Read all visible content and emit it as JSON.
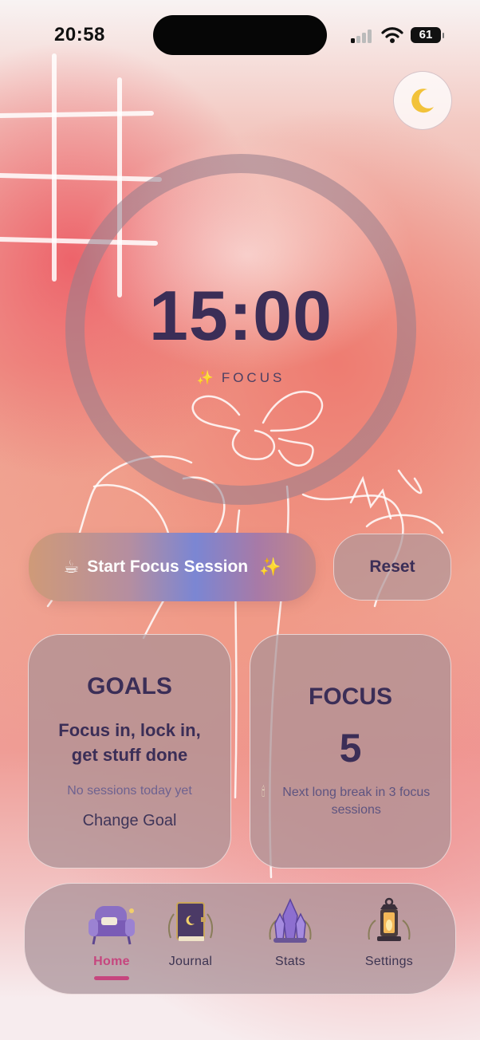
{
  "status_bar": {
    "time": "20:58",
    "battery": "61"
  },
  "theme_toggle": {
    "icon": "moon-icon",
    "emoji": "🌙"
  },
  "timer": {
    "time": "15:00",
    "mode_icon": "✨",
    "mode": "FOCUS"
  },
  "controls": {
    "start_icon": "☕",
    "start_label": "Start Focus Session",
    "start_spark": "✨",
    "reset_label": "Reset"
  },
  "goals_card": {
    "title": "GOALS",
    "goal": "Focus in, lock in, get stuff done",
    "status": "No sessions today yet",
    "change_label": "Change Goal"
  },
  "focus_card": {
    "title": "FOCUS",
    "count": "5",
    "note_icon": "🕯",
    "note": "Next long break in 3 focus sessions"
  },
  "tabs": [
    {
      "label": "Home",
      "icon": "armchair-icon",
      "active": true
    },
    {
      "label": "Journal",
      "icon": "book-icon",
      "active": false
    },
    {
      "label": "Stats",
      "icon": "crystal-icon",
      "active": false
    },
    {
      "label": "Settings",
      "icon": "lantern-icon",
      "active": false
    }
  ],
  "colors": {
    "text_primary": "#3b2e57",
    "active_tab": "#c6457e",
    "spark": "#e9b73d"
  }
}
